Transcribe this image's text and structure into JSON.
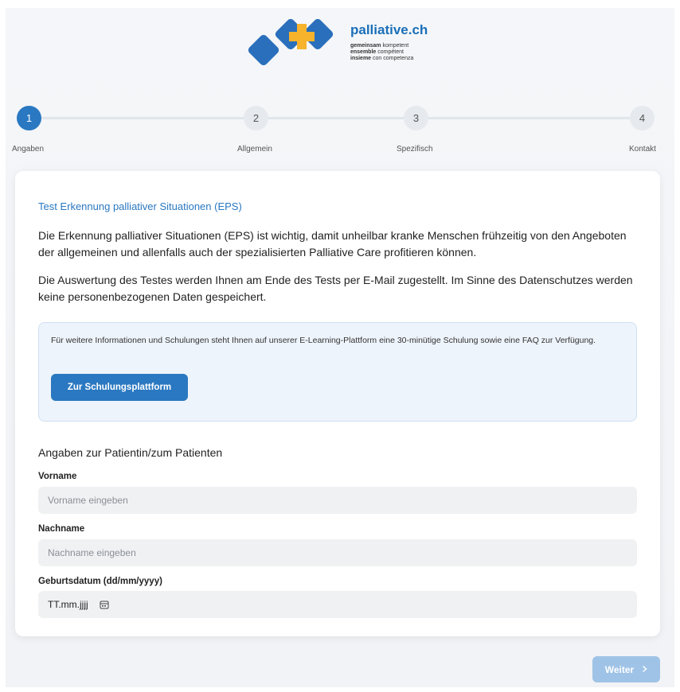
{
  "header": {
    "brand": "palliative.ch",
    "tagline": [
      {
        "bold": "gemeinsam",
        "rest": " kompetent"
      },
      {
        "bold": "ensemble",
        "rest": " compétent"
      },
      {
        "bold": "insieme",
        "rest": " con competenza"
      }
    ],
    "logo_colors": {
      "blue": "#2a6fbb",
      "orange": "#f7b32b"
    }
  },
  "stepper": {
    "current_step": 1,
    "steps": [
      {
        "number": "1",
        "label": "Angaben"
      },
      {
        "number": "2",
        "label": "Allgemein"
      },
      {
        "number": "3",
        "label": "Spezifisch"
      },
      {
        "number": "4",
        "label": "Kontakt"
      }
    ]
  },
  "card": {
    "title": "Test Erkennung palliativer Situationen (EPS)",
    "paragraph1": "Die Erkennung palliativer Situationen (EPS) ist wichtig, damit unheilbar kranke Menschen frühzeitig von den Angeboten der allgemeinen und allenfalls auch der spezialisierten Palliative Care profitieren können.",
    "paragraph2": "Die Auswertung des Testes werden Ihnen am Ende des Tests per E-Mail zugestellt. Im Sinne des Datenschutzes werden keine personenbezogenen Daten gespeichert.",
    "info_box": {
      "text": "Für weitere Informationen und Schulungen steht Ihnen auf unserer E-Learning-Plattform eine 30-minütige Schulung sowie eine FAQ zur Verfügung.",
      "button_label": "Zur Schulungsplattform"
    },
    "section_title": "Angaben zur Patientin/zum Patienten",
    "fields": {
      "vorname": {
        "label": "Vorname",
        "value": "",
        "placeholder": "Vorname eingeben"
      },
      "nachname": {
        "label": "Nachname",
        "value": "",
        "placeholder": "Nachname eingeben"
      },
      "geburtsdatum": {
        "label": "Geburtsdatum (dd/mm/yyyy)",
        "value": "TT.mm.jjjj",
        "icon": "calendar-icon"
      }
    }
  },
  "footer": {
    "next_label": "Weiter",
    "next_icon": "chevron-right-icon"
  },
  "colors": {
    "accent": "#2a78c1",
    "accent_disabled": "#9fc3e6",
    "info_bg": "#eef4fb"
  }
}
